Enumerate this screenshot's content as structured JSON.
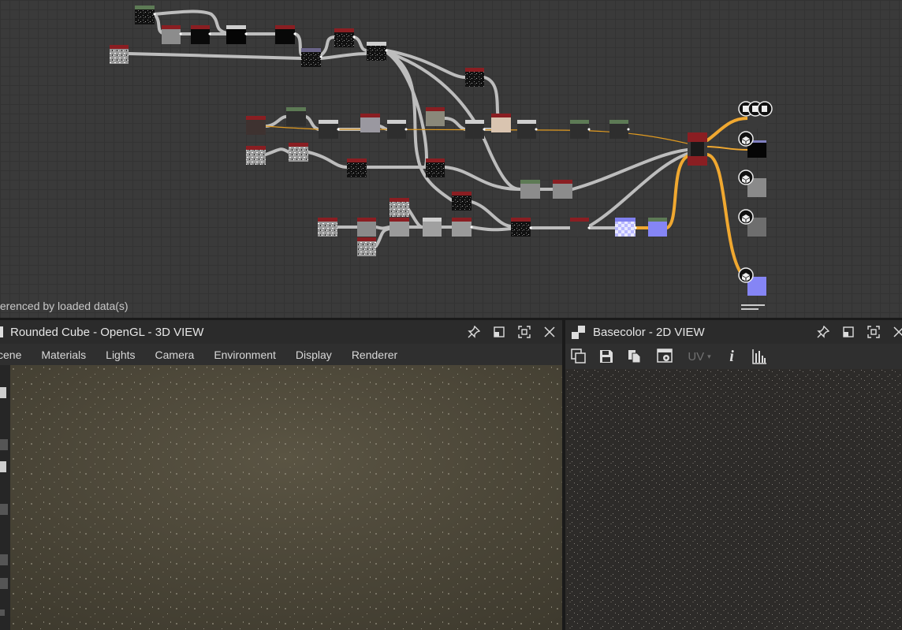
{
  "graph": {
    "status_text": "ferenced by loaded data(s)"
  },
  "view3d": {
    "title": "Rounded Cube - OpenGL - 3D VIEW",
    "menu": [
      "cene",
      "Materials",
      "Lights",
      "Camera",
      "Environment",
      "Display",
      "Renderer"
    ]
  },
  "view2d": {
    "title": "Basecolor - 2D VIEW",
    "uv_label": "UV",
    "info_label": "i"
  },
  "colors": {
    "graph_bg": "#3a3a3a",
    "wire": "#bdbdbd",
    "wire_orange": "#f0a830",
    "node_red": "#8a1e22",
    "output_blue": "#8080f0"
  },
  "icons": [
    "pin-icon",
    "restore-icon",
    "maximize-icon",
    "close-icon",
    "checker-icon",
    "save-icon",
    "copy-icon",
    "settings-icon",
    "histogram-icon",
    "cube-icon"
  ]
}
